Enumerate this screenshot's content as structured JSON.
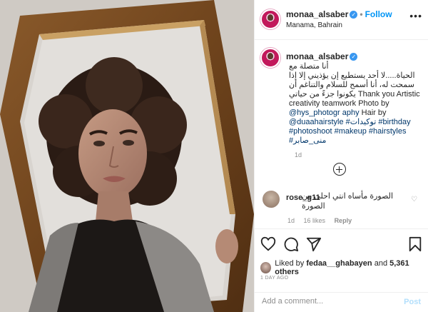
{
  "post": {
    "username": "monaa_alsaber",
    "verified_mark": "✓",
    "dot": "•",
    "follow_label": "Follow",
    "location": "Manama, Bahrain",
    "more_icon": "more-options-icon"
  },
  "caption": {
    "username": "monaa_alsaber",
    "line1": "أنا متصلة مع",
    "line2": "الحياة.....لا أحد يستطيع إن يؤذيني إلا إذا",
    "line3": "سمحت له، أنا أسمح للسلام والتناغم أن",
    "line4a": "يكونوا جزءً من حياتي",
    "line4b": " Thank you Artistic",
    "line5": "creativity teamwork Photo by",
    "line6_mention": "@hys_photogr aphy",
    "line6_rest": " Hair by",
    "line7_mention": "@duaahairstyle",
    "line7_tag1": " #توكيدات",
    "line7_tag2": " #birthday",
    "line8": "#photoshoot #makeup #hairstyles",
    "line9": "#منى_صابر",
    "timestamp": "1d"
  },
  "comment": {
    "username": "rose_g11",
    "text": "الصورة مأساه انتي احلى من الصورة",
    "time": "1d",
    "likes": "16 likes",
    "reply_label": "Reply"
  },
  "actions": {
    "liked_by_prefix": "Liked by",
    "liked_by_user": "fedaa__ghabayen",
    "and_label": "and",
    "others_count": "5,361 others",
    "ago": "1 DAY AGO"
  },
  "add_comment": {
    "placeholder": "Add a comment...",
    "post_label": "Post"
  },
  "colors": {
    "accent": "#0095f6",
    "link": "#00376b",
    "muted": "#8e8e8e",
    "verified": "#3897f0"
  }
}
